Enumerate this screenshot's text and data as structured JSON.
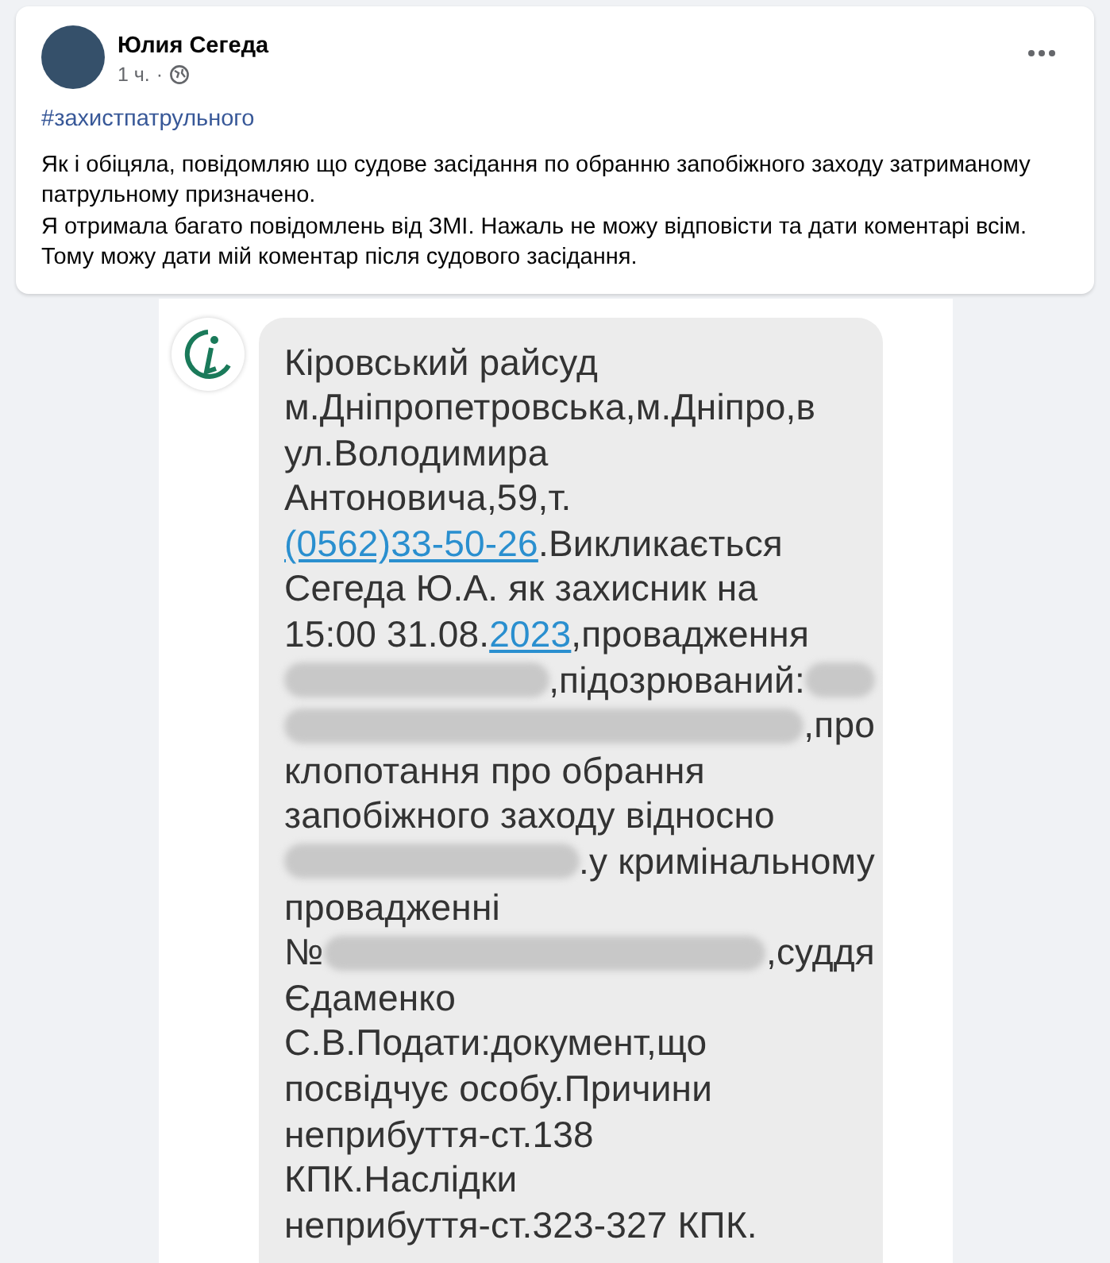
{
  "post": {
    "author": "Юлия Сегеда",
    "time": "1 ч.",
    "separator": "·",
    "hashtag": "#захистпатрульного",
    "body": [
      "Як і обіцяла, повідомляю що судове засідання по обранню запобіжного заходу затриманому патрульному призначено.",
      "Я отримала багато повідомлень від ЗМІ. Нажаль не можу відповісти та дати коментарі всім.",
      "Тому можу дати мій коментар після судового засідання."
    ]
  },
  "sms": {
    "lines": [
      [
        {
          "kind": "text",
          "text": "Кіровський райсуд"
        }
      ],
      [
        {
          "kind": "text",
          "text": "м.Дніпропетровська,м.Дніпро,в"
        }
      ],
      [
        {
          "kind": "text",
          "text": "ул.Володимира"
        }
      ],
      [
        {
          "kind": "text",
          "text": "Антоновича,59,т."
        }
      ],
      [
        {
          "kind": "link",
          "text": "(0562)33-50-26"
        },
        {
          "kind": "text",
          "text": ".Викликається"
        }
      ],
      [
        {
          "kind": "text",
          "text": "Сегеда Ю.А. як захисник на"
        }
      ],
      [
        {
          "kind": "text",
          "text": "15:00 31.08."
        },
        {
          "kind": "link",
          "text": "2023"
        },
        {
          "kind": "text",
          "text": ",провадження"
        }
      ],
      [
        {
          "kind": "redacted"
        },
        {
          "kind": "text",
          "text": ",підозрюваний:"
        },
        {
          "kind": "redacted"
        }
      ],
      [
        {
          "kind": "redacted"
        },
        {
          "kind": "text",
          "text": ",про"
        }
      ],
      [
        {
          "kind": "text",
          "text": "клопотання про обрання"
        }
      ],
      [
        {
          "kind": "text",
          "text": "запобіжного заходу відносно"
        }
      ],
      [
        {
          "kind": "redacted"
        },
        {
          "kind": "text",
          "text": ".у кримінальному"
        }
      ],
      [
        {
          "kind": "text",
          "text": "провадженні"
        }
      ],
      [
        {
          "kind": "text",
          "text": "№"
        },
        {
          "kind": "redacted"
        },
        {
          "kind": "text",
          "text": ",суддя"
        }
      ],
      [
        {
          "kind": "text",
          "text": "Єдаменко"
        }
      ],
      [
        {
          "kind": "text",
          "text": "С.В.Подати:документ,що"
        }
      ],
      [
        {
          "kind": "text",
          "text": "посвідчує особу.Причини"
        }
      ],
      [
        {
          "kind": "text",
          "text": "неприбуття-ст.138"
        }
      ],
      [
        {
          "kind": "text",
          "text": "КПК.Наслідки"
        }
      ],
      [
        {
          "kind": "text",
          "text": "неприбуття-ст.323-327 КПК."
        }
      ]
    ]
  }
}
